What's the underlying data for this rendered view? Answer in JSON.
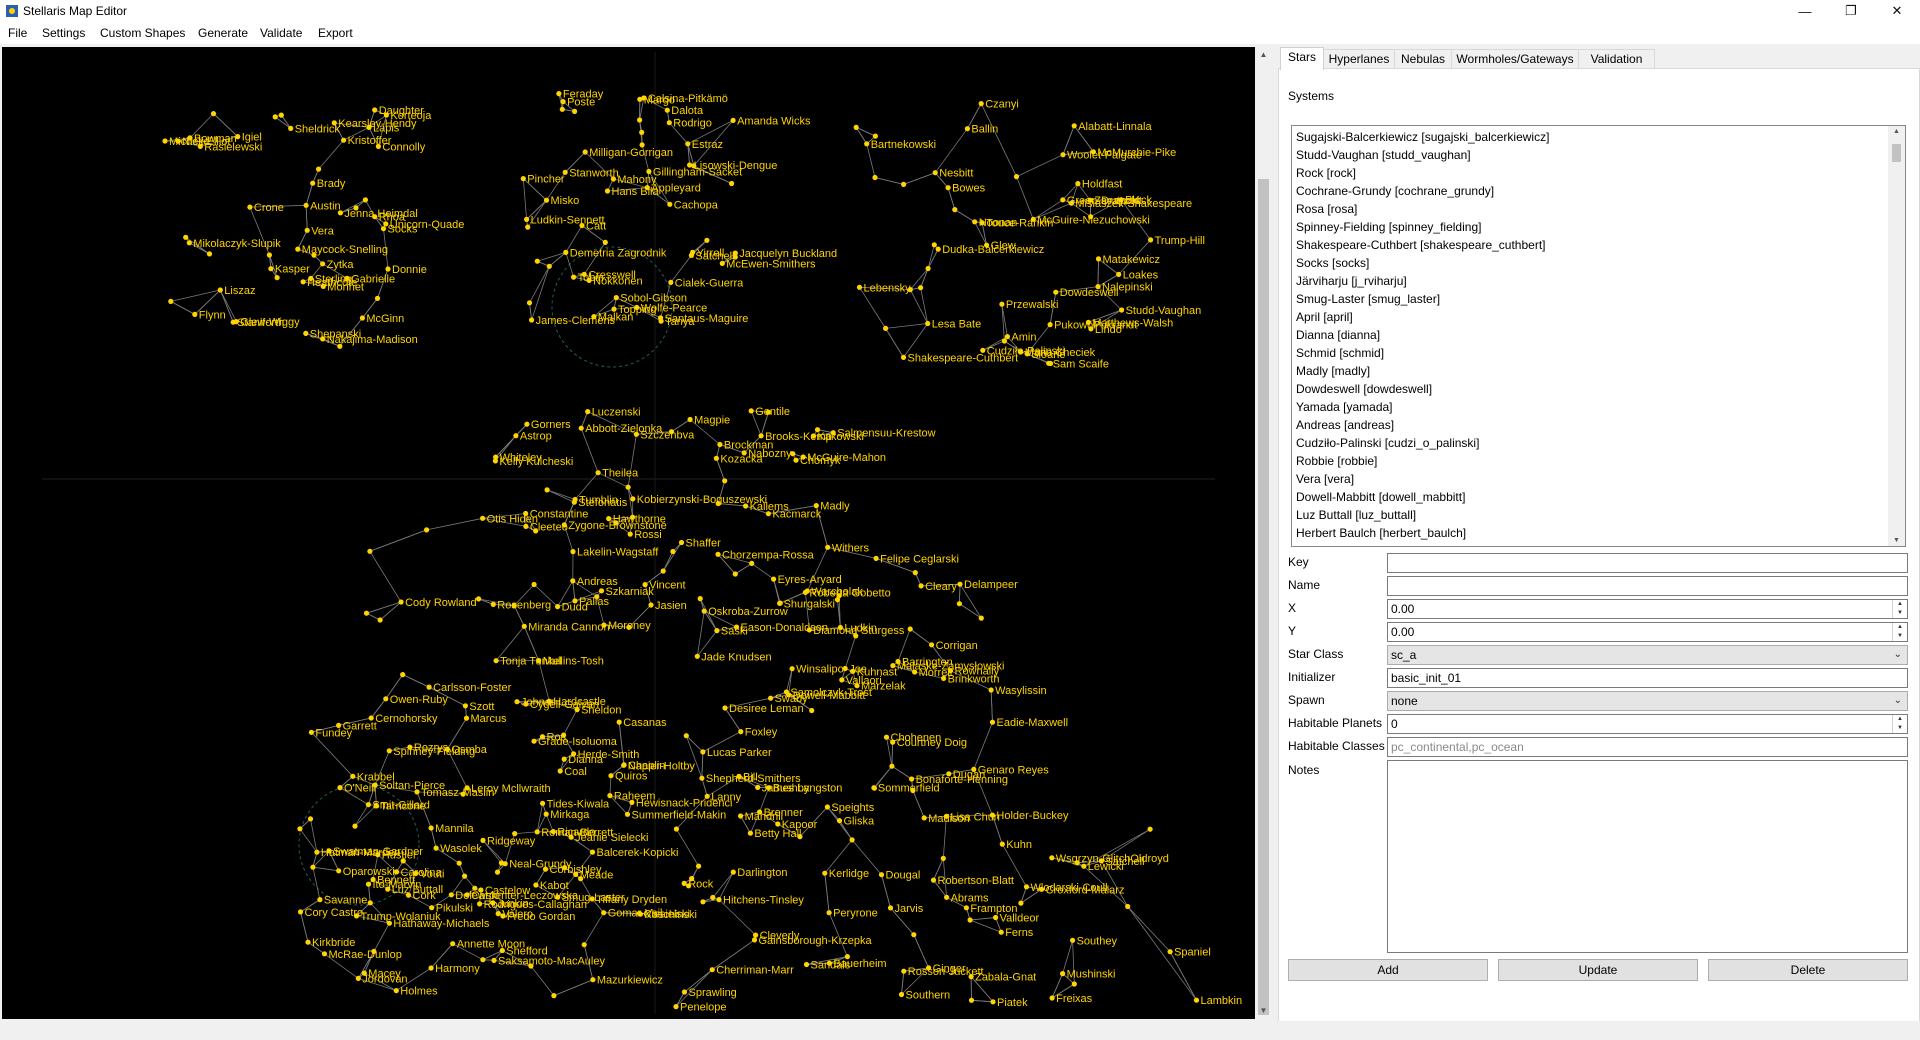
{
  "window": {
    "title": "Stellaris Map Editor"
  },
  "menu": [
    "File",
    "Settings",
    "Custom Shapes",
    "Generate",
    "Validate",
    "Export"
  ],
  "tabs": [
    "Stars",
    "Hyperlanes",
    "Nebulas",
    "Wormholes/Gateways",
    "Validation"
  ],
  "systems_label": "Systems",
  "systems": [
    "Sugajski-Balcerkiewicz [sugajski_balcerkiewicz]",
    "Studd-Vaughan [studd_vaughan]",
    "Rock [rock]",
    "Cochrane-Grundy [cochrane_grundy]",
    "Rosa [rosa]",
    "Spinney-Fielding [spinney_fielding]",
    "Shakespeare-Cuthbert [shakespeare_cuthbert]",
    "Socks [socks]",
    "Järviharju [j_rviharju]",
    "Smug-Laster [smug_laster]",
    "April [april]",
    "Dianna [dianna]",
    "Schmid [schmid]",
    "Madly [madly]",
    "Dowdeswell [dowdeswell]",
    "Yamada [yamada]",
    "Andreas [andreas]",
    "Cudziło-Palinski [cudzi_o_palinski]",
    "Robbie [robbie]",
    "Vera [vera]",
    "Dowell-Mabbitt [dowell_mabbitt]",
    "Luz Buttall [luz_buttall]",
    "Herbert Baulch [herbert_baulch]"
  ],
  "form": {
    "key_label": "Key",
    "key_value": "",
    "name_label": "Name",
    "name_value": "",
    "x_label": "X",
    "x_value": "0.00",
    "y_label": "Y",
    "y_value": "0.00",
    "star_class_label": "Star Class",
    "star_class_value": "sc_a",
    "initializer_label": "Initializer",
    "initializer_value": "basic_init_01",
    "spawn_label": "Spawn",
    "spawn_value": "none",
    "habitable_planets_label": "Habitable Planets",
    "habitable_planets_value": "0",
    "habitable_classes_label": "Habitable Classes",
    "habitable_classes_placeholder": "pc_continental,pc_ocean",
    "notes_label": "Notes"
  },
  "buttons": {
    "add": "Add",
    "update": "Update",
    "delete": "Delete"
  },
  "colors": {
    "star": "#ffd400",
    "map_bg": "#000000",
    "hyperlane": "#7a7a7a"
  },
  "map_labels": [
    "Brady",
    "Tanya",
    "Dowdeswell",
    "Dudd",
    "Napier-Holtby",
    "Corrigan",
    "Grade-Isoluoma",
    "Corbishley",
    "Sandals",
    "McGinn",
    "Misko",
    "Misiaszek-Shakespeare",
    "Theilea",
    "Shepherd-Smithers",
    "Joe",
    "Ros",
    "Ito-Marvin",
    "Jarvis",
    "Unicorn-Quade",
    "Estraz",
    "Cudziło-Palinski",
    "McGuire-Mahon",
    "Coal",
    "Cleary",
    "Marcus",
    "Tiffany Dryden",
    "Wsgrzyn-GlitchOldroyd",
    "Crone",
    "Topping",
    "Czanyi",
    "Luczenski",
    "Hawthorne",
    "Diamond-Sturgess",
    "Rozrys",
    "Ciesielski",
    "Zabala-Gnat",
    "Heathcote",
    "Ludkin-Sennett",
    "Glew",
    "Nabozny",
    "Tides-Kiwala",
    "Samolczyk-Trost",
    "Jeanie Sielecki",
    "Kirkbride",
    "Wlodarski-Coull",
    "Gabrielle",
    "Cresswell",
    "Trump-Hill",
    "Zygone-Brownstone",
    "Quiros",
    "Chohenen",
    "Cory Castro",
    "Oparowski",
    "Ginger",
    "Staniforth",
    "Tobin",
    "Noonan",
    "Kelly Kulcheski",
    "Chaplin",
    "Lisa Chun",
    "Carpenter-Leczowska",
    "Mannila",
    "Peryrone",
    "Sterling",
    "Cachopa",
    "Sam Scaife",
    "Gentile",
    "Andreas",
    "Morrell",
    "Hustler",
    "Dolewski",
    "Kerlidge",
    "Mikolaczyk-Slupik",
    "Jacquelyn Buckland",
    "Amin",
    "Chomyk",
    "Mullins-Tosh",
    "Bushby",
    "Owen-Ruby",
    "Smug-Laster",
    "Betty Hall",
    "Bowman",
    "Satchell",
    "Green-Draycott",
    "Tumblin",
    "Oskroba-Zurrow",
    "James Langston",
    "Hathaway-Michaels",
    "Carolina",
    "Piatek",
    "Liszaz",
    "Nokkonen",
    "Dudka-Balcerkiewicz",
    "Kacmarck",
    "Casanas",
    "Roberta Gobetto",
    "Cygell-Galvan",
    "Trump-Wolaniuk",
    "Robertson-Blatt",
    "Zytka",
    "Gillingham-Sacket",
    "Touce-Rankin",
    "Kozacka",
    "Lanny",
    "Barrington",
    "Dianna",
    "Savanne",
    "Southern",
    "Korteoja",
    "Mahony",
    "Shakespeare-Cuthbert",
    "Moroney",
    "Summerfield-Makin",
    "Brinkworth",
    "Junkin",
    "Harmony",
    "Ferns",
    "Sheldrick",
    "McEwen-Smithers",
    "Lebensky",
    "Szkarniak",
    "Hewisnack-Pridenci",
    "Sommerfield",
    "Garrett",
    "Holmes",
    "Satchell",
    "Glew-Wiggy",
    "Yirrell",
    "Woolet-Palgate",
    "Warcholak",
    "Vincent",
    "Eyres-Aryard",
    "Krabbel",
    "Fredo Gordan",
    "Darlington",
    "Shepanski",
    "Poste",
    "Lesa Bate",
    "Shaffer",
    "Lakelin-Wagstaff",
    "Rownally",
    "Ridgeway",
    "Wasolek",
    "Valldeor",
    "Jenna Heimdal",
    "James-Clemens",
    "Lindo",
    "Abbott-Zielonka",
    "Raheem",
    "Vallaori",
    "Balcerek-Kopicki",
    "Shefford",
    "Frampton",
    "Monnet",
    "Milligan-Gorrigan",
    "Bartnekowski",
    "Madly",
    "Otis Hiden",
    "Brenner",
    "Roman-Berrett",
    "Cherriman-Marr",
    "Mushinski",
    "Donnie",
    "Rodrigo",
    "Zarutucki",
    "Kallems",
    "Jade Knudsen",
    "Foxley",
    "Fundey",
    "Hitchens-Tinsley",
    "Madison",
    "Rhoa",
    "Santaus-Maguire",
    "Matthews-Walsh",
    "Szczenbva",
    "Rossi",
    "Bill",
    "Cork",
    "Meade",
    "Kapoor",
    "Maycock-Snelling",
    "Dalota",
    "Nesbitt",
    "Gorners",
    "Cody Rowland",
    "Delampeer",
    "Pikulski",
    "McRae-Dunlop",
    "Croxford-Malarz",
    "Michelle",
    "Demetria Zagrodnik",
    "Nalepinski",
    "Stefonatis",
    "Osmba",
    "Eason-Donaldson",
    "Soltan-Pierce",
    "Rodrigues-Callaghan",
    "Mandrill",
    "Lapis",
    "Wolfe-Pearce",
    "McMurchie-Pike",
    "Astrop",
    "Lucas Parker",
    "Speights",
    "Cernohorsky",
    "Annette Moon",
    "Abrams",
    "Kasper",
    "Margo",
    "Marie Checiek",
    "Shurgalski",
    "Tonja Tunkel",
    "Swaby",
    "Tarricone",
    "Koschinski",
    "Rosson-Juckett",
    "Socks",
    "Hans Bila",
    "Matakewicz",
    "Ludkin",
    "Chorzempa-Rossa",
    "Courtney Doig",
    "Smit-Gillard",
    "Jordovan",
    "Gliska",
    "Flynn",
    "Feraday",
    "Holdfast",
    "Salmensuu-Krestow",
    "Saski",
    "Winsalipo",
    "O'Neill",
    "Gomar-Vail",
    "Southey",
    "Nakajima-Madison",
    "Lisowski-Dengue",
    "Alabatt-Linnala",
    "Brockman",
    "Cleeteo",
    "Wasylissin",
    "Kabot",
    "Saksamoto-MacAuley",
    "Holder-Buckey",
    "Connolly",
    "Pincher",
    "Ballin",
    "Kobierzynski-Boguszewski",
    "Herde-Smith",
    "Felipe Ceglarski",
    "Hardcastle",
    "Ricardo",
    "Dougal",
    "Nick Elliot",
    "Malkan",
    "Sloane",
    "Jasien",
    "Spinney-Fielding",
    "Kuhnast",
    "Bennett",
    "Rock",
    "Kuhn",
    "Vera",
    "Calsina-Pitkämö",
    "Bowes",
    "Kakowski",
    "Carlsson-Foster",
    "Dugan",
    "Castelow",
    "Macey",
    "Gainsborough-Krzepka",
    "Kristoffer",
    "Appleyard",
    "Loakes",
    "Pallas",
    "Leroy Mcllwraith",
    "Bonaforte-Henning",
    "Johnar",
    "Penelope",
    "Lewicki",
    "Rasielewski",
    "Stanworth",
    "Block",
    "Brooks-Kemp",
    "Szott",
    "Malaske-Zamysłowski",
    "Tomasz-Maslin",
    "Vouti",
    "Spaniel",
    "Igiel",
    "Cialek-Guerra",
    "Przewalski",
    "Whiteley",
    "Mirkaga",
    "Genaro Reyes",
    "Swatman-Gardner",
    "Valero",
    "Lambkin",
    "Daughter",
    "Amanda Wicks",
    "PukowoPukrandt",
    "Withers",
    "Rosenberg",
    "Eadie-Maxwell",
    "Neal-Grundy",
    "Luz Buttall",
    "Freixas",
    "Austin",
    "Sobol-Gibson",
    "Studd-Vaughan",
    "Magpie",
    "Desiree Leman",
    "Marzelak",
    "Hatman-Marden",
    "Sprawling",
    "Bauerheim",
    "Kearsley-Hendy",
    "Catt",
    "McGuire-Niezuchowski",
    "Constantine",
    "Miranda Cannon",
    "Dowell-Mabbitt",
    "Sheldon",
    "Mazurkiewicz",
    "Cleverly"
  ]
}
